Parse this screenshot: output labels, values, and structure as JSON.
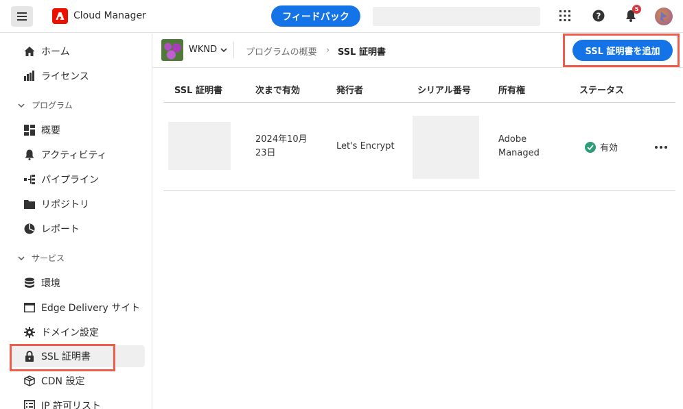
{
  "header": {
    "app_title": "Cloud Manager",
    "feedback_label": "フィードバック",
    "search_placeholder": "",
    "notification_count": "5"
  },
  "sidebar": {
    "items": [
      {
        "label": "ホーム",
        "icon": "home-icon"
      },
      {
        "label": "ライセンス",
        "icon": "license-icon"
      },
      {
        "section": "プログラム"
      },
      {
        "label": "概要",
        "icon": "dashboard-icon"
      },
      {
        "label": "アクティビティ",
        "icon": "bell-icon"
      },
      {
        "label": "パイプライン",
        "icon": "pipeline-icon"
      },
      {
        "label": "リポジトリ",
        "icon": "folder-icon"
      },
      {
        "label": "レポート",
        "icon": "report-icon"
      },
      {
        "section": "サービス"
      },
      {
        "label": "環境",
        "icon": "database-icon"
      },
      {
        "label": "Edge Delivery サイト",
        "icon": "window-icon"
      },
      {
        "label": "ドメイン設定",
        "icon": "gear-icon"
      },
      {
        "label": "SSL 証明書",
        "icon": "lock-icon",
        "active": true
      },
      {
        "label": "CDN 設定",
        "icon": "cube-icon"
      },
      {
        "label": "IP 許可リスト",
        "icon": "list-icon"
      }
    ]
  },
  "breadcrumb": {
    "program": "WKND",
    "parent": "プログラムの概要",
    "separator": "›",
    "current": "SSL 証明書"
  },
  "actions": {
    "add_label": "SSL 証明書を追加"
  },
  "table": {
    "headers": [
      "SSL 証明書",
      "次まで有効",
      "発行者",
      "シリアル番号",
      "所有権",
      "ステータス"
    ],
    "rows": [
      {
        "valid_until_line1": "2024年10月",
        "valid_until_line2": "23日",
        "issuer": "Let's Encrypt",
        "ownership_line1": "Adobe",
        "ownership_line2": "Managed",
        "status": "有効"
      }
    ]
  },
  "colors": {
    "accent": "#1473e6",
    "highlight": "#f05c4b",
    "status_ok": "#2d9d78",
    "brand": "#eb1000"
  }
}
